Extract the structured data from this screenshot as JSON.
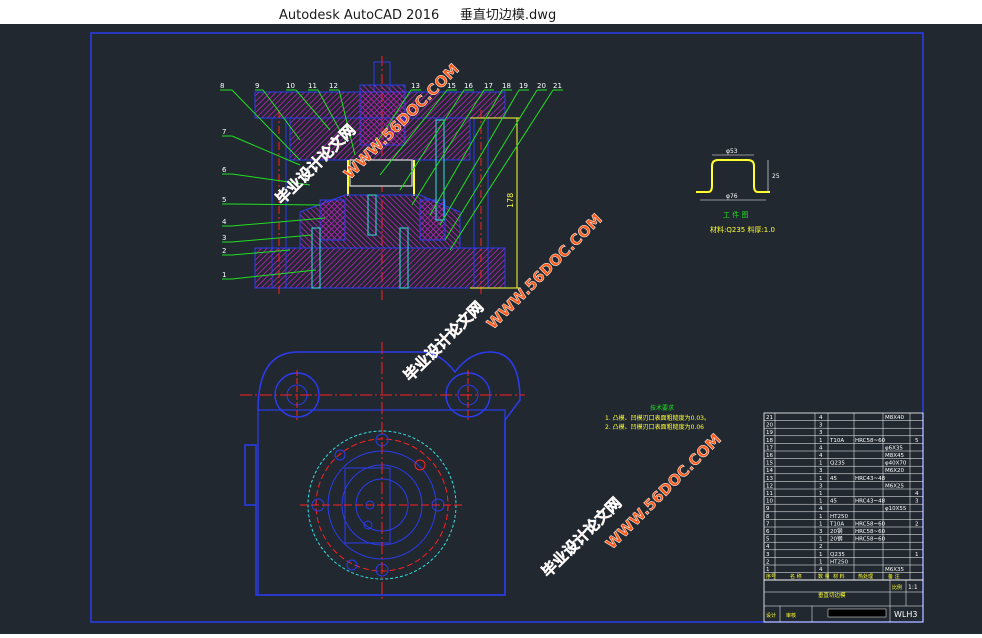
{
  "window": {
    "app_title": "Autodesk AutoCAD 2016",
    "file_name": "垂直切边模.dwg"
  },
  "drawing": {
    "callouts_top": [
      "8",
      "9",
      "10",
      "11",
      "12",
      "13",
      "15",
      "16",
      "17",
      "18",
      "19",
      "20",
      "21"
    ],
    "callouts_left": [
      "7",
      "6",
      "5",
      "4",
      "3",
      "2",
      "1"
    ],
    "dimension": "178",
    "part_view": {
      "dims": {
        "top": "φ53",
        "bottom": "φ76",
        "height": "25"
      },
      "caption": "工 件 图",
      "material": "材料:Q235  料厚:1.0"
    },
    "tech_notes": {
      "heading": "技术要求",
      "line1": "1. 凸模、凹模刃口表面粗糙度为0.03。",
      "line2": "2. 凸模、凹模刃口表面粗糙度为0.06"
    },
    "watermarks": {
      "site": "WWW.56DOC.COM",
      "name": "毕业设计论文网"
    },
    "bom_rows": [
      {
        "no": "21",
        "qty": "4",
        "mat": "",
        "hard": "",
        "note": "M8X40",
        "extra": ""
      },
      {
        "no": "20",
        "qty": "3",
        "mat": "",
        "hard": "",
        "note": "",
        "extra": ""
      },
      {
        "no": "19",
        "qty": "3",
        "mat": "",
        "hard": "",
        "note": "",
        "extra": ""
      },
      {
        "no": "18",
        "qty": "1",
        "mat": "T10A",
        "hard": "HRC58~60",
        "note": "",
        "extra": "5"
      },
      {
        "no": "17",
        "qty": "4",
        "mat": "",
        "hard": "",
        "note": "φ6X35",
        "extra": ""
      },
      {
        "no": "16",
        "qty": "4",
        "mat": "",
        "hard": "",
        "note": "M8X45",
        "extra": ""
      },
      {
        "no": "15",
        "qty": "1",
        "mat": "Q235",
        "hard": "",
        "note": "φ40X70",
        "extra": ""
      },
      {
        "no": "14",
        "qty": "3",
        "mat": "",
        "hard": "",
        "note": "M6X20",
        "extra": ""
      },
      {
        "no": "13",
        "qty": "1",
        "mat": "45",
        "hard": "HRC43~48",
        "note": "",
        "extra": ""
      },
      {
        "no": "12",
        "qty": "3",
        "mat": "",
        "hard": "",
        "note": "M6X25",
        "extra": ""
      },
      {
        "no": "11",
        "qty": "1",
        "mat": "",
        "hard": "",
        "note": "",
        "extra": "4"
      },
      {
        "no": "10",
        "qty": "1",
        "mat": "45",
        "hard": "HRC43~48",
        "note": "",
        "extra": "3"
      },
      {
        "no": "9",
        "qty": "4",
        "mat": "",
        "hard": "",
        "note": "φ10X55",
        "extra": ""
      },
      {
        "no": "8",
        "qty": "1",
        "mat": "HT250",
        "hard": "",
        "note": "",
        "extra": ""
      },
      {
        "no": "7",
        "qty": "1",
        "mat": "T10A",
        "hard": "HRC58~60",
        "note": "",
        "extra": "2"
      },
      {
        "no": "6",
        "qty": "3",
        "mat": "20钢",
        "hard": "HRC58~60",
        "note": "",
        "extra": ""
      },
      {
        "no": "5",
        "qty": "1",
        "mat": "20钢",
        "hard": "HRC58~60",
        "note": "",
        "extra": ""
      },
      {
        "no": "4",
        "qty": "2",
        "mat": "",
        "hard": "",
        "note": "",
        "extra": ""
      },
      {
        "no": "3",
        "qty": "1",
        "mat": "Q235",
        "hard": "",
        "note": "",
        "extra": "1"
      },
      {
        "no": "2",
        "qty": "1",
        "mat": "HT250",
        "hard": "",
        "note": "",
        "extra": ""
      },
      {
        "no": "1",
        "qty": "4",
        "mat": "",
        "hard": "",
        "note": "M6X35",
        "extra": ""
      }
    ],
    "bom_header": {
      "no": "序号",
      "name": "名 称",
      "qty": "数 量",
      "mat": "材 料",
      "hard": "热处理",
      "note": "备 注"
    },
    "title_block": {
      "ratio_label": "比例",
      "ratio": "1:1",
      "drawing_no": "WLH3",
      "name": "垂直切边模",
      "designer": "设计",
      "checker": "审核"
    }
  },
  "colors": {
    "background": "#212830",
    "frame": "#2b3cf0",
    "outline": "#2b3cf0",
    "hatch": "#c020c0",
    "center": "#ff2020",
    "callout": "#20e020",
    "label": "#ffffff",
    "note": "#ffff30",
    "cyan": "#30e0e0",
    "watermark": "#ff5a1a"
  }
}
